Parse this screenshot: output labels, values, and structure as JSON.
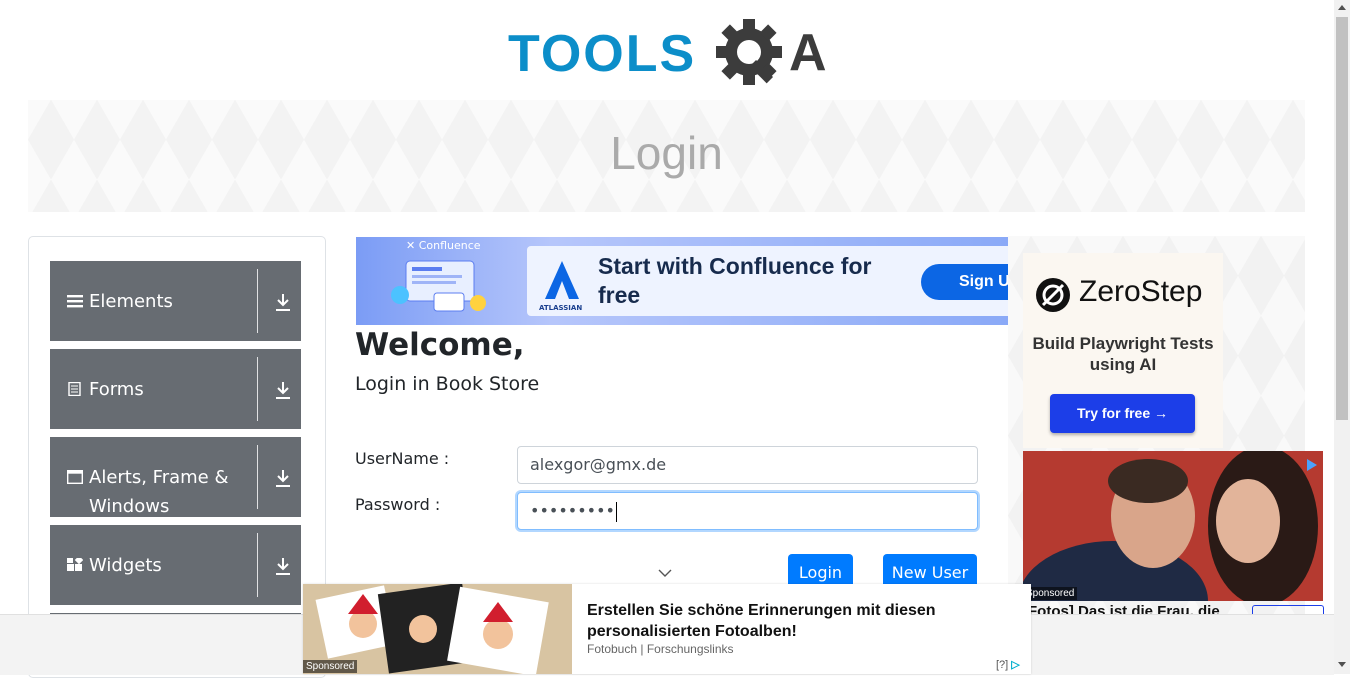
{
  "header": {
    "logo_text": "TOOLS",
    "logo_suffix": "A"
  },
  "banner": {
    "title": "Login"
  },
  "sidebar": {
    "groups": [
      {
        "label": "Elements",
        "icon": "hamburger-icon"
      },
      {
        "label": "Forms",
        "icon": "document-icon"
      },
      {
        "label": "Alerts, Frame & Windows",
        "icon": "window-icon"
      },
      {
        "label": "Widgets",
        "icon": "widgets-icon"
      }
    ]
  },
  "top_ad": {
    "brand": "Confluence",
    "vendor": "ATLASSIAN",
    "headline": "Start with Confluence for free",
    "cta": "Sign Up"
  },
  "login": {
    "welcome": "Welcome,",
    "subtitle": "Login in Book Store",
    "username_label": "UserName :",
    "username_value": "alexgor@gmx.de",
    "password_label": "Password :",
    "password_value": "•••••••••",
    "login_button": "Login",
    "new_user_button": "New User"
  },
  "right_ad": {
    "brand": "ZeroStep",
    "tagline": "Build Playwright Tests using AI",
    "cta": "Try for free →",
    "sponsored": "Sponsored",
    "caption": "Fotos] Das ist die Frau, die"
  },
  "bottom_ad": {
    "sponsored": "Sponsored",
    "headline": "Erstellen Sie schöne Erinnerungen mit diesen personalisierten Fotoalben!",
    "source": "Fotobuch | Forschungslinks",
    "adchoice": "[?]"
  },
  "colors": {
    "logo_blue": "#0c8ec9",
    "logo_gray": "#3c3c3c",
    "sidebar_group": "#676c72",
    "primary_button": "#007bff",
    "zerostep_button": "#1c3ee8"
  }
}
